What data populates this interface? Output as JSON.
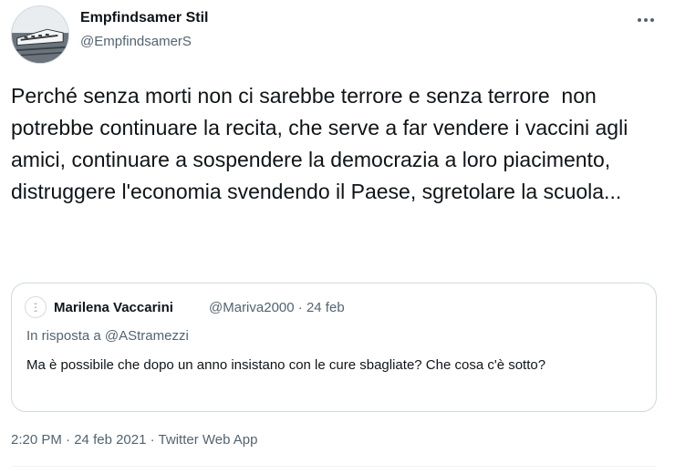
{
  "author": {
    "name": "Empfindsamer Stil",
    "handle": "@EmpfindsamerS"
  },
  "tweet": {
    "text": "Perché senza morti non ci sarebbe terrore e senza terrore  non potrebbe continuare la recita, che serve a far vendere i vaccini agli amici, continuare a sospendere la democrazia a loro piacimento, distruggere l'economia svendendo il Paese, sgretolare la scuola..."
  },
  "quote": {
    "name": "Marilena Vaccarini",
    "handle": "@Mariva2000",
    "separator": "·",
    "date": "24 feb",
    "reply_prefix": "In risposta a",
    "reply_handle": "@AStramezzi",
    "text": "Ma è possibile che dopo un anno insistano con le cure sbagliate? Che cosa c'è sotto?"
  },
  "footer": {
    "time": "2:20 PM",
    "separator": "·",
    "date": "24 feb 2021",
    "source": "Twitter Web App"
  },
  "icons": {
    "more": "more-horizontal-icon"
  }
}
